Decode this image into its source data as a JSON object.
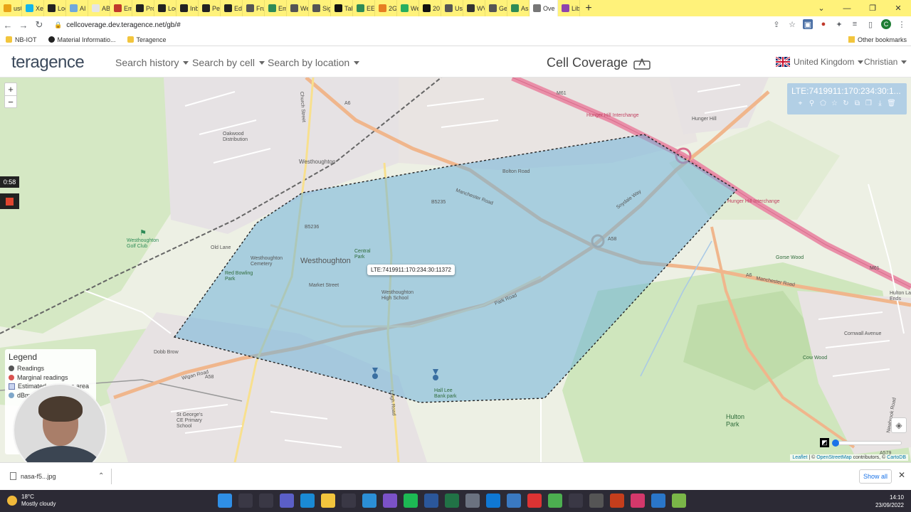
{
  "browser": {
    "tabs": [
      {
        "label": "us0",
        "color": "#e8a317"
      },
      {
        "label": "Xer",
        "color": "#13b5ea"
      },
      {
        "label": "Log",
        "color": "#222222"
      },
      {
        "label": "AI f",
        "color": "#6fa8dc"
      },
      {
        "label": "ABC",
        "color": "#e5e5e5"
      },
      {
        "label": "Ema",
        "color": "#c0392b"
      },
      {
        "label": "Pro",
        "color": "#222222"
      },
      {
        "label": "Log",
        "color": "#222222"
      },
      {
        "label": "Inb",
        "color": "#222222"
      },
      {
        "label": "Peo",
        "color": "#222222"
      },
      {
        "label": "Edu",
        "color": "#222222"
      },
      {
        "label": "Fru",
        "color": "#555555"
      },
      {
        "label": "Em",
        "color": "#2e8b57"
      },
      {
        "label": "We",
        "color": "#555555"
      },
      {
        "label": "Sig",
        "color": "#555555"
      },
      {
        "label": "Tab",
        "color": "#111111"
      },
      {
        "label": "EE 3",
        "color": "#2e8b57"
      },
      {
        "label": "2G",
        "color": "#e67e22"
      },
      {
        "label": "We",
        "color": "#27ae60"
      },
      {
        "label": "20",
        "color": "#111111"
      },
      {
        "label": "Use",
        "color": "#555555"
      },
      {
        "label": "WV",
        "color": "#333333"
      },
      {
        "label": "Ge",
        "color": "#555555"
      },
      {
        "label": "Ass",
        "color": "#2e8b57"
      },
      {
        "label": "Ove",
        "color": "#777777"
      }
    ],
    "active_tab_close": "×",
    "last_tab": {
      "label": "Libr",
      "color": "#8e44ad"
    },
    "new_tab": "+",
    "window_controls": {
      "collapse": "⌄",
      "minimize": "—",
      "restore": "❐",
      "close": "✕"
    },
    "url": "cellcoverage.dev.teragence.net/gb/#",
    "bookmarks": [
      "NB-IOT",
      "Material Informatio...",
      "Teragence"
    ],
    "other_bookmarks": "Other bookmarks",
    "profile_initial": "C"
  },
  "app": {
    "logo": "teragence",
    "menu": {
      "search_history": "Search history",
      "search_by_cell": "Search by cell",
      "search_by_location": "Search by location"
    },
    "title": "Cell Coverage",
    "country": "United Kingdom",
    "user": "Christian"
  },
  "map": {
    "zoom_in": "+",
    "zoom_out": "−",
    "recording_time": "0:58",
    "cell_tooltip": "LTE:7419911:170:234:30:11372",
    "cell_id_panel": "LTE:7419911:170:234:30:1...",
    "labels": {
      "westhoughton_small": "Westhoughton",
      "westhoughton_big": "Westhoughton",
      "oakwood": "Oakwood\nDistribution",
      "golf": "Westhoughton\nGolf Club",
      "hunger_hill": "Hunger Hill Interchange",
      "hunger_hill_2": "Hunger Hill Interchange",
      "hunger_hill_town": "Hunger Hill",
      "manchester_road": "Manchester Road",
      "manchester_road_2": "Manchester Road",
      "wigan_road": "Wigan Road",
      "park_road": "Park Road",
      "snydale_way": "Snydale Way",
      "bolton_road": "Bolton Road",
      "a6": "A6",
      "a6_2": "A6",
      "a58": "A58",
      "a58_2": "A58",
      "m61": "M61",
      "m61_2": "M61",
      "b5235": "B5235",
      "b5236": "B5236",
      "hulton_park": "Hulton\nPark",
      "hall_lee": "Hall Lee\nBank park",
      "st_georges": "St George's\nCE Primary\nSchool",
      "high_school": "Westhoughton\nHigh School",
      "cemetery": "Westhoughton\nCemetery",
      "cow_wood": "Cow Wood",
      "gorse_wood": "Gorse Wood",
      "hulton_lane": "Hulton Lane\nEnds",
      "church_street": "Church Street",
      "leigh_road": "Leigh Road",
      "old_lane": "Old Lane",
      "dobb_brow": "Dobb Brow",
      "market_street": "Market Street",
      "central_park": "Central\nPark",
      "red_bowling": "Red Bowling\nPark",
      "cornwall_avenue": "Cornwall Avenue",
      "newbrook_road": "Newbrook Road",
      "a579": "A579"
    },
    "legend": {
      "title": "Legend",
      "items": [
        {
          "label": "Readings",
          "color": "#555555",
          "shape": "dot"
        },
        {
          "label": "Marginal readings",
          "color": "#d9534f",
          "shape": "dot"
        },
        {
          "label": "Estimated coverage area",
          "color": "#c8d3ef",
          "shape": "square"
        },
        {
          "label": "dBm",
          "color": "#7fa7c9",
          "shape": "dot"
        }
      ]
    },
    "attribution": {
      "leaflet": "Leaflet",
      "sep": " | © ",
      "osm": "OpenStreetMap",
      "contributors": " contributors, © ",
      "carto": "CartoDB"
    },
    "polygon_color": "#6fb3d9"
  },
  "downloads": {
    "file": "nasa-f5...jpg",
    "show_all": "Show all",
    "close": "✕"
  },
  "taskbar": {
    "temperature": "18°C",
    "weather": "Mostly cloudy",
    "time": "14:10",
    "date": "23/09/2022",
    "apps": [
      {
        "icon": "windows-start-icon",
        "color": "#2f8fe6"
      },
      {
        "icon": "search-icon",
        "color": "#3a3845"
      },
      {
        "icon": "task-view-icon",
        "color": "#3a3845"
      },
      {
        "icon": "teams-icon",
        "color": "#5b5fc7"
      },
      {
        "icon": "edge-icon",
        "color": "#1a8ad4"
      },
      {
        "icon": "file-explorer-icon",
        "color": "#f2c53d"
      },
      {
        "icon": "store-icon",
        "color": "#3a3845"
      },
      {
        "icon": "vscode-icon",
        "color": "#2b8fd6"
      },
      {
        "icon": "app-icon",
        "color": "#7b52c7"
      },
      {
        "icon": "spotify-icon",
        "color": "#1db954"
      },
      {
        "icon": "word-icon",
        "color": "#2b579a"
      },
      {
        "icon": "excel-icon",
        "color": "#217346"
      },
      {
        "icon": "settings-icon",
        "color": "#6b7280"
      },
      {
        "icon": "outlook-icon",
        "color": "#0f78d4"
      },
      {
        "icon": "mail-icon",
        "color": "#3a79c1"
      },
      {
        "icon": "acrobat-icon",
        "color": "#d33"
      },
      {
        "icon": "chrome-icon",
        "color": "#4caf50"
      },
      {
        "icon": "calculator-icon",
        "color": "#3a3845"
      },
      {
        "icon": "app-icon-2",
        "color": "#555"
      },
      {
        "icon": "powerpoint-icon",
        "color": "#c43e1c"
      },
      {
        "icon": "app-icon-3",
        "color": "#d4386b"
      },
      {
        "icon": "remote-icon",
        "color": "#2a76c9"
      },
      {
        "icon": "qgis-icon",
        "color": "#7ab648"
      }
    ]
  }
}
